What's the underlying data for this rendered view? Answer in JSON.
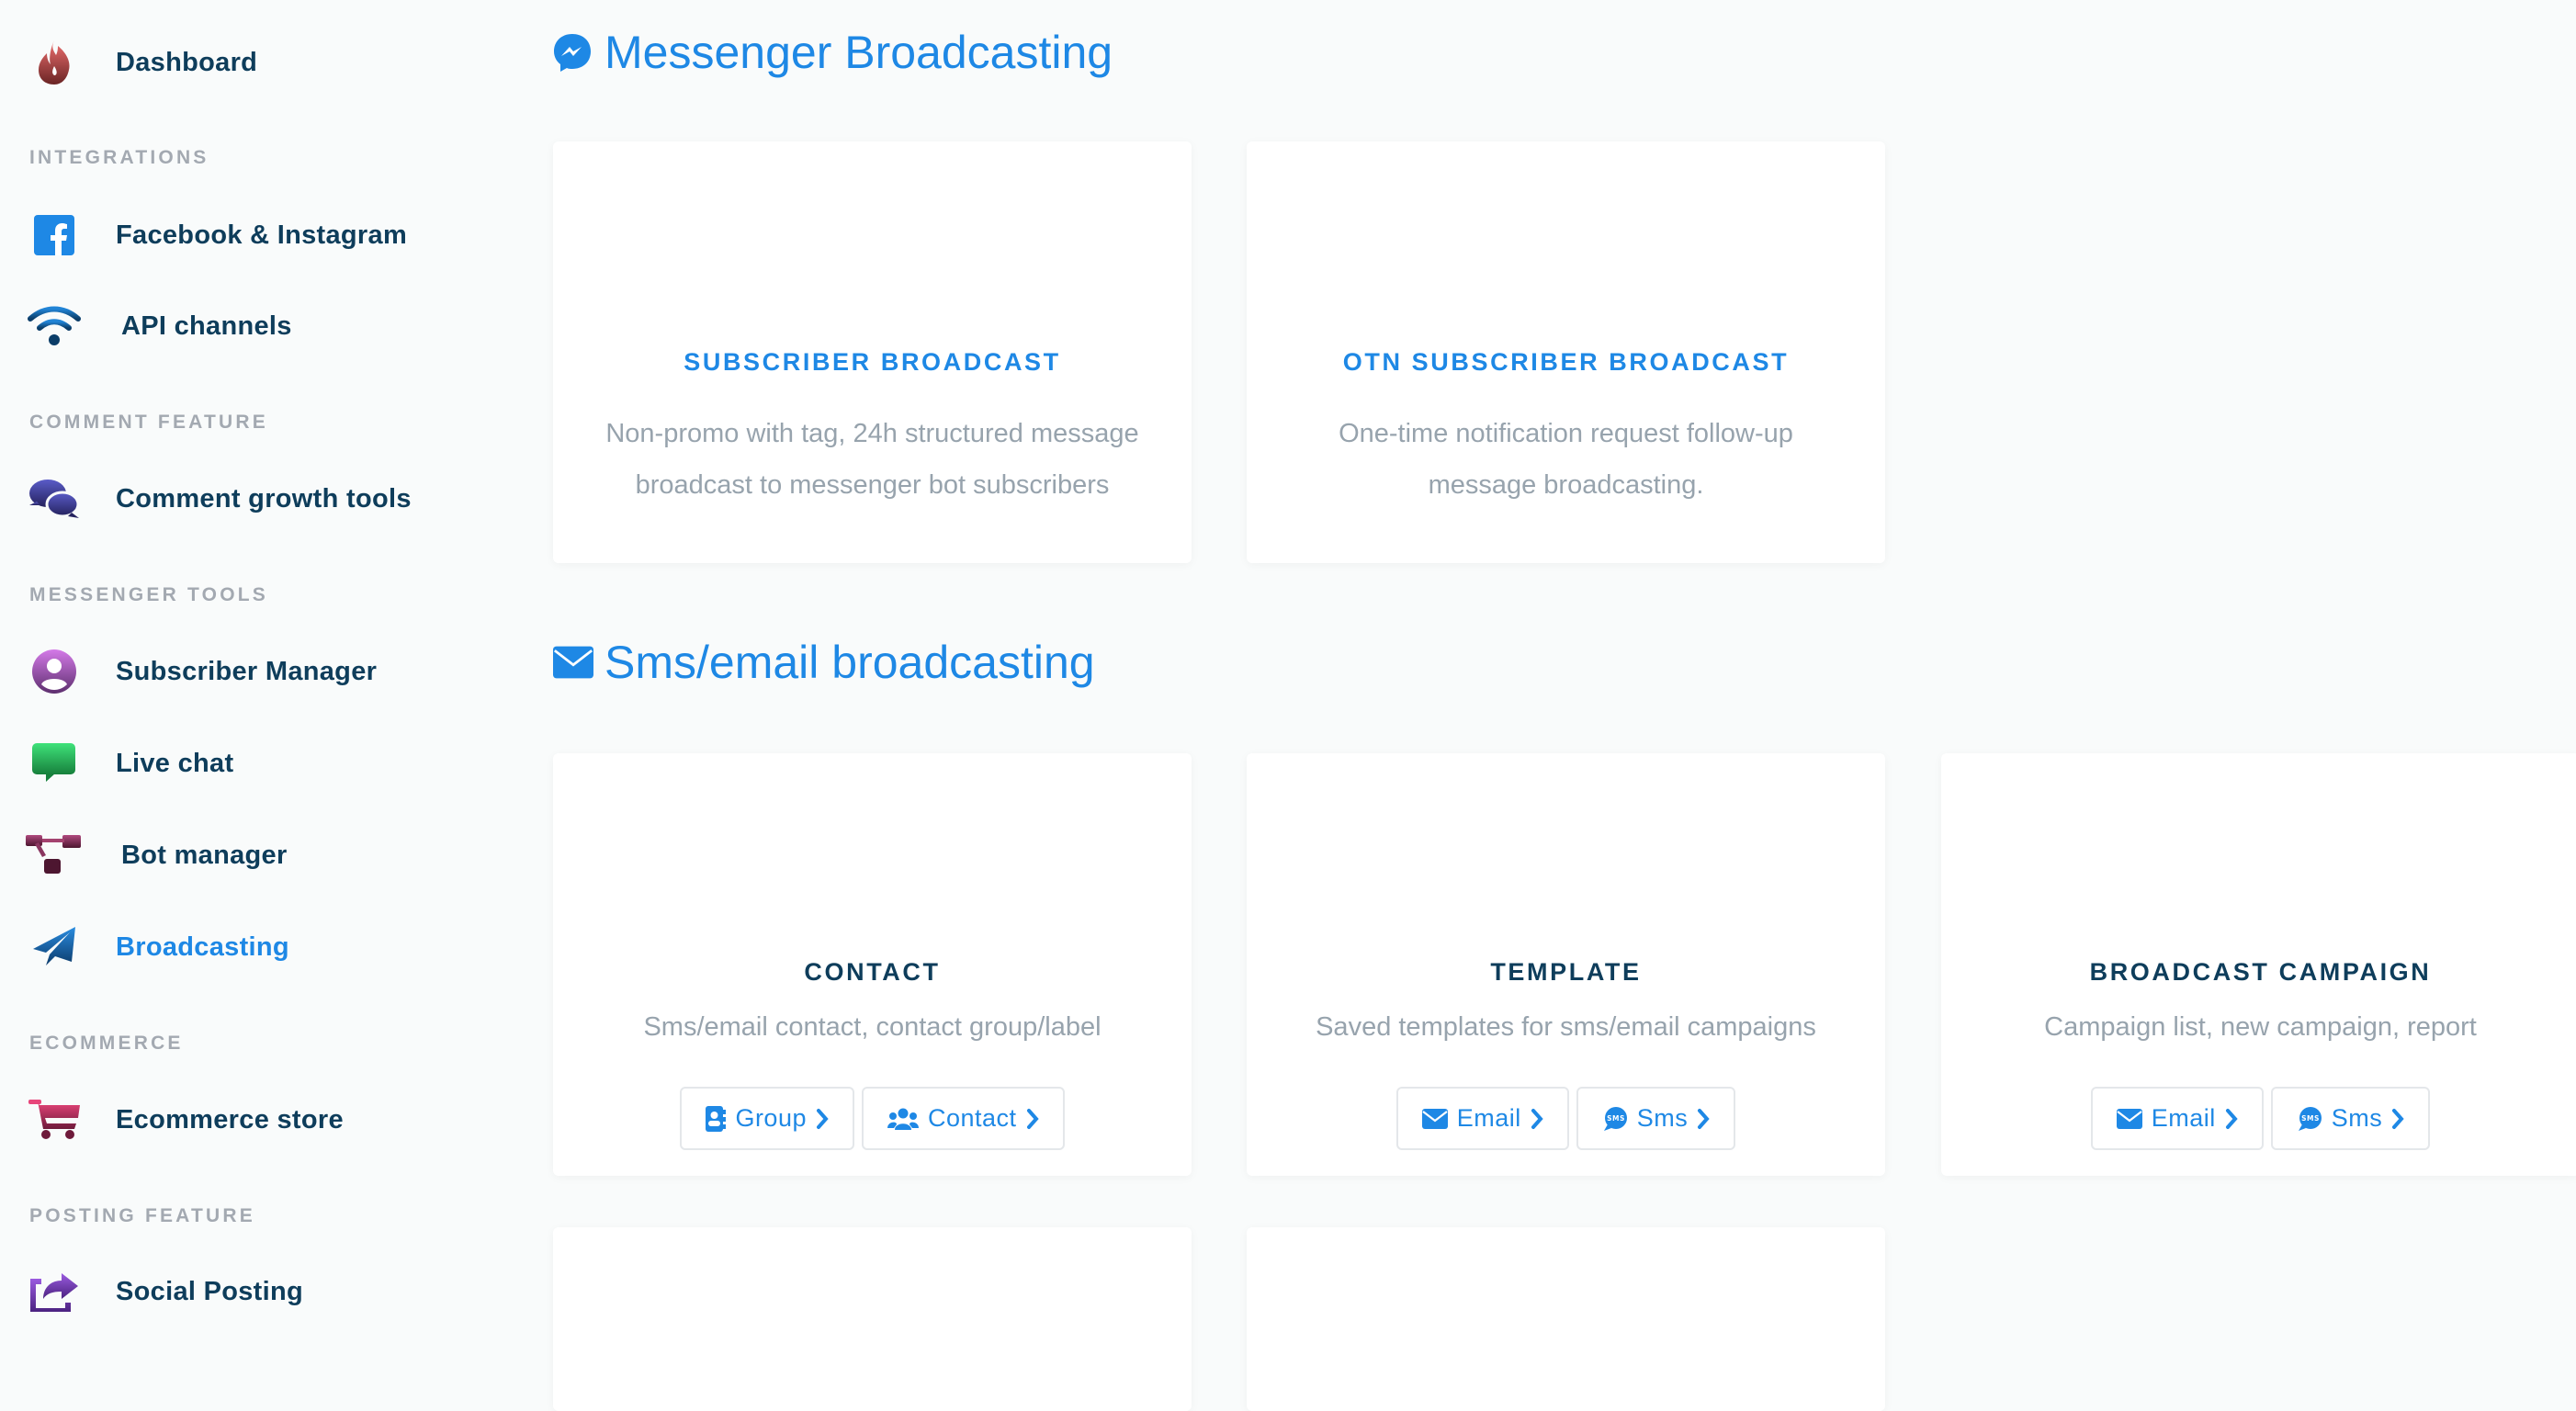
{
  "sidebar": {
    "items": [
      {
        "label": "Dashboard",
        "icon": "fire-icon"
      },
      {
        "section": "INTEGRATIONS"
      },
      {
        "label": "Facebook & Instagram",
        "icon": "facebook-icon"
      },
      {
        "label": "API channels",
        "icon": "wifi-icon"
      },
      {
        "section": "COMMENT FEATURE"
      },
      {
        "label": "Comment growth tools",
        "icon": "comments-icon"
      },
      {
        "section": "MESSENGER TOOLS"
      },
      {
        "label": "Subscriber Manager",
        "icon": "user-circle-icon"
      },
      {
        "label": "Live chat",
        "icon": "chat-bubble-icon"
      },
      {
        "label": "Bot manager",
        "icon": "sitemap-icon"
      },
      {
        "label": "Broadcasting",
        "icon": "paper-plane-icon",
        "active": true
      },
      {
        "section": "ECOMMERCE"
      },
      {
        "label": "Ecommerce store",
        "icon": "shopping-cart-icon"
      },
      {
        "section": "POSTING FEATURE"
      },
      {
        "label": "Social Posting",
        "icon": "share-icon"
      }
    ]
  },
  "messenger": {
    "title": "Messenger Broadcasting",
    "icon": "messenger-icon",
    "cards": [
      {
        "title": "SUBSCRIBER BROADCAST",
        "description": "Non-promo with tag, 24h structured message broadcast to messenger bot subscribers"
      },
      {
        "title": "OTN SUBSCRIBER BROADCAST",
        "description": "One-time notification request follow-up message broadcasting."
      }
    ]
  },
  "sms_email": {
    "title": "Sms/email broadcasting",
    "icon": "envelope-icon",
    "cards": [
      {
        "title": "CONTACT",
        "description": "Sms/email contact, contact group/label",
        "buttons": [
          {
            "label": "Group",
            "icon": "address-book-icon"
          },
          {
            "label": "Contact",
            "icon": "users-icon"
          }
        ]
      },
      {
        "title": "TEMPLATE",
        "description": "Saved templates for sms/email campaigns",
        "buttons": [
          {
            "label": "Email",
            "icon": "envelope-icon"
          },
          {
            "label": "Sms",
            "icon": "sms-icon"
          }
        ]
      },
      {
        "title": "BROADCAST CAMPAIGN",
        "description": "Campaign list, new campaign, report",
        "buttons": [
          {
            "label": "Email",
            "icon": "envelope-icon"
          },
          {
            "label": "Sms",
            "icon": "sms-icon"
          }
        ]
      }
    ]
  },
  "colors": {
    "accent": "#1e88e5",
    "heading_dark": "#0e3d5b",
    "muted": "#97a3ad",
    "section_label": "#a3a9b1",
    "background": "#f9fbfb"
  }
}
